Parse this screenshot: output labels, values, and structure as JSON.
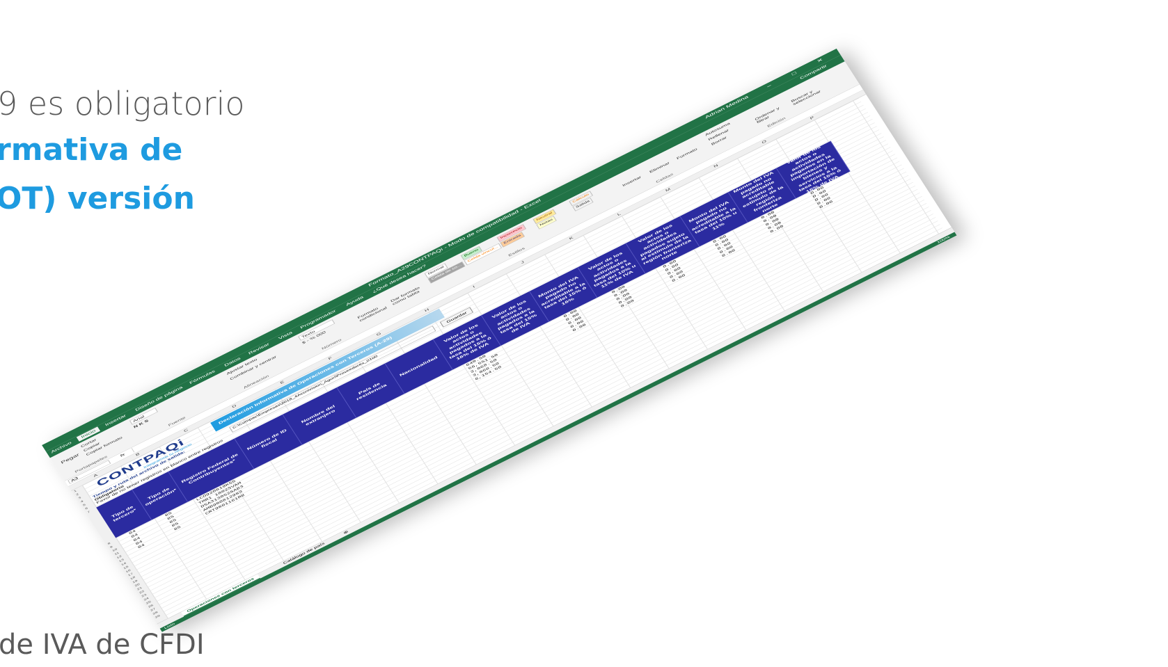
{
  "background": {
    "line1": "9 es obligatorio",
    "line2": "rmativa de",
    "line3": "OT) versión",
    "line4": "de IVA de CFDI"
  },
  "window": {
    "title": "Formato_A29CONTPAQi - Modo de compatibilidad - Excel",
    "user": "Adrian Medina",
    "share": "Compartir",
    "tell_me": "¿Qué desea hacer?",
    "controls": "– □ ✕"
  },
  "ribbon_tabs": [
    "Archivo",
    "Inicio",
    "Insertar",
    "Diseño de página",
    "Fórmulas",
    "Datos",
    "Revisar",
    "Vista",
    "Programador",
    "Ayuda"
  ],
  "ribbon": {
    "paste": "Pegar",
    "cut": "Cortar",
    "copy": "Copiar",
    "format_painter": "Copiar formato",
    "clipboard": "Portapapeles",
    "font_name": "Arial",
    "font_group": "Fuente",
    "wrap": "Ajustar texto",
    "merge": "Combinar y centrar",
    "align_group": "Alineación",
    "number_format": "Texto",
    "number_group": "Número",
    "cond_format": "Formato condicional",
    "as_table": "Dar formato como tabla",
    "styles_group": "Estilos",
    "styles": [
      "Normal",
      "Bueno",
      "Incorrecto",
      "Neutral",
      "Cálculo",
      "Celda de co...",
      "Celda vincul...",
      "Entrada",
      "Notas",
      "Salida"
    ],
    "insert": "Insertar",
    "delete": "Eliminar",
    "format": "Formato",
    "cells_group": "Celdas",
    "autosum": "Autosuma",
    "fill": "Rellenar",
    "clear": "Borrar",
    "sort": "Ordenar y filtrar",
    "find": "Buscar y seleccionar",
    "edit_group": "Edición"
  },
  "formula_bar": {
    "name_box": "A3",
    "fx": "fx"
  },
  "columns": [
    "A",
    "B",
    "C",
    "D",
    "E",
    "F",
    "G",
    "H",
    "I",
    "J",
    "K",
    "L",
    "M",
    "N",
    "O",
    "P"
  ],
  "sheet": {
    "logo": "CONTPAQi",
    "tagline": "Integramos tu negocio",
    "banner": "Declaración Informativa de Operaciones con Terceros (A-29)",
    "path_label": "Tiempo y ruta del archivo de salida:",
    "required": "Obligatorio",
    "note": "Favor de no tener registros en blanco entre registros",
    "path_value": "C:\\Compac\\Empresas\\2018_4Accnivision_Aguri\\Proveedores_0100",
    "save": "Guardar"
  },
  "headers": [
    "Tipo de tercero*",
    "Tipo de operación*",
    "Registro Federal de Contribuyentes*",
    "Número de ID fiscal",
    "Nombre del extranjero",
    "País de residencia",
    "Nacionalidad",
    "Valor de los actos o actividades pagados a la tasa del 15% ó 16% de IVA",
    "Valor de los actos o actividades pagados a la tasa del 15% de IVA",
    "Monto del IVA pagado no acreditable a la tasa del 15% ó 16%",
    "Valor de los actos o actividades pagados a la tasa del 10% u 11% de IVA",
    "Valor de los actos o actividades pagados sujeto al estímulo de la región fronteriza norte",
    "Monto del IVA pagado no acreditable a la tasa del 10% u 11%",
    "Monto del IVA pagado no acreditable sujeto al estímulo de la región fronteriza norte",
    "Valor de los actos o actividades pagados en la importación de bienes y servicios a la tasa del 15% ó 16% de IVA"
  ],
  "rows": {
    "tipo_tercero": [
      "04",
      "04",
      "04",
      "04",
      "04"
    ],
    "tipo_operacion": [
      "85",
      "85",
      "85",
      "85",
      "85"
    ],
    "rfc": [
      "LCO920819KS5",
      "TMR1 1002SVAM",
      "DSA3130526A83",
      "AMB900812983",
      "CRT9801161R8"
    ],
    "valor_16": [
      "640.50",
      "56,551.50",
      "3,068.50",
      "3,068.50",
      "6,154.50"
    ],
    "zeros": [
      "0.00",
      "0.00",
      "0.00",
      "0.00",
      "0.00"
    ]
  },
  "sheet_tabs": [
    "Operaciones con terceros",
    "Catálogo de país"
  ],
  "status": {
    "ready": "Listo",
    "zoom": "100%"
  }
}
